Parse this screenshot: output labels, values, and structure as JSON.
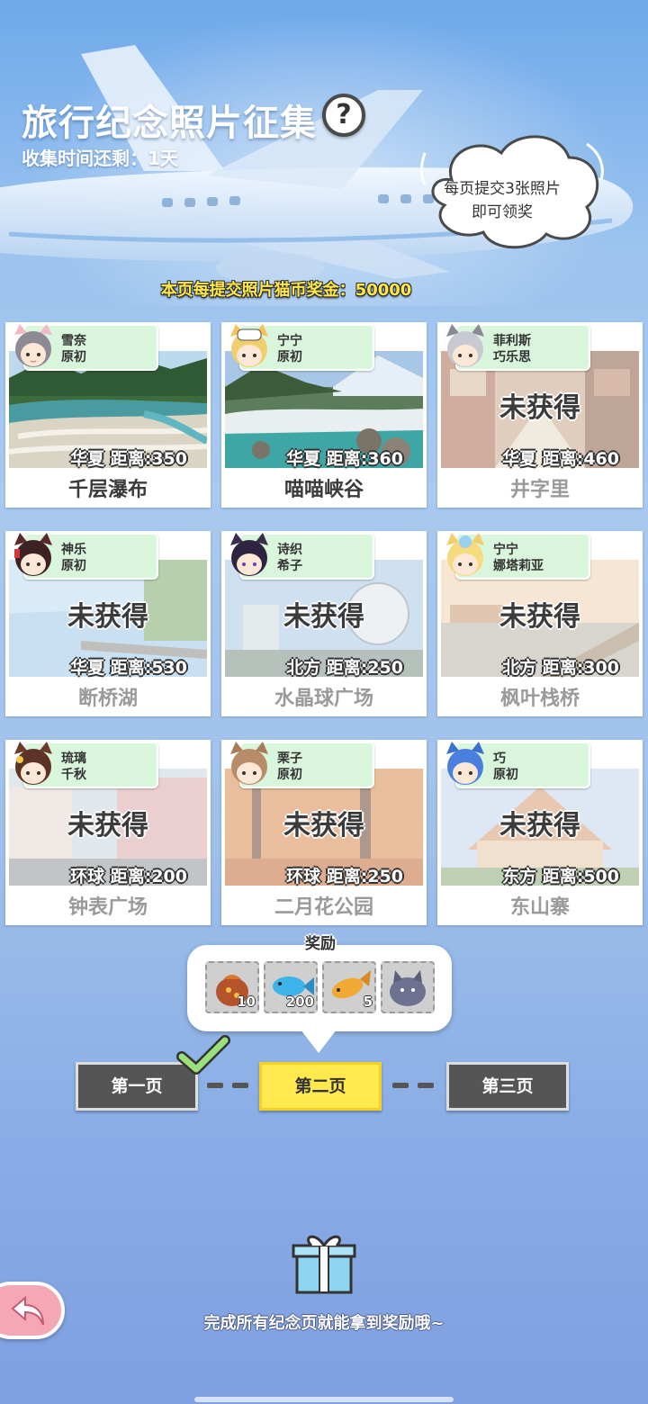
{
  "header": {
    "title": "旅行纪念照片征集",
    "help_glyph": "?",
    "time_label": "收集时间还剩：",
    "time_value": "1天",
    "bubble_line1": "每页提交3张照片",
    "bubble_line2": "即可领奖"
  },
  "bonus_text": "本页每提交照片猫币奖金：50000",
  "photos": [
    {
      "char_line1": "雪奈",
      "char_line2": "原初",
      "status": "",
      "region": "华夏",
      "distance": "距离:350",
      "name": "千层瀑布",
      "obtained": true
    },
    {
      "char_line1": "宁宁",
      "char_line2": "原初",
      "status": "",
      "region": "华夏",
      "distance": "距离:360",
      "name": "喵喵峡谷",
      "obtained": true
    },
    {
      "char_line1": "菲利斯",
      "char_line2": "巧乐思",
      "status": "未获得",
      "region": "华夏",
      "distance": "距离:460",
      "name": "井字里",
      "obtained": false
    },
    {
      "char_line1": "神乐",
      "char_line2": "原初",
      "status": "未获得",
      "region": "华夏",
      "distance": "距离:530",
      "name": "断桥湖",
      "obtained": false
    },
    {
      "char_line1": "诗织",
      "char_line2": "希子",
      "status": "未获得",
      "region": "北方",
      "distance": "距离:250",
      "name": "水晶球广场",
      "obtained": false
    },
    {
      "char_line1": "宁宁",
      "char_line2": "娜塔莉亚",
      "status": "未获得",
      "region": "北方",
      "distance": "距离:300",
      "name": "枫叶栈桥",
      "obtained": false
    },
    {
      "char_line1": "琉璃",
      "char_line2": "千秋",
      "status": "未获得",
      "region": "环球",
      "distance": "距离:200",
      "name": "钟表广场",
      "obtained": false
    },
    {
      "char_line1": "栗子",
      "char_line2": "原初",
      "status": "未获得",
      "region": "环球",
      "distance": "距离:250",
      "name": "二月花公园",
      "obtained": false
    },
    {
      "char_line1": "巧",
      "char_line2": "原初",
      "status": "未获得",
      "region": "东方",
      "distance": "距离:500",
      "name": "东山寨",
      "obtained": false
    }
  ],
  "rewards": {
    "title": "奖励",
    "items": [
      {
        "icon": "candy-bag-icon",
        "count": "10"
      },
      {
        "icon": "blue-fish-icon",
        "count": "200"
      },
      {
        "icon": "golden-fish-icon",
        "count": "5"
      },
      {
        "icon": "cat-plush-icon",
        "count": ""
      }
    ]
  },
  "pages": {
    "page1": "第一页",
    "page2": "第二页",
    "page3": "第三页",
    "active": "page2",
    "completed": [
      "page1"
    ]
  },
  "footer": {
    "text": "完成所有纪念页就能拿到奖励哦~"
  },
  "colors": {
    "accent_yellow": "#ffe94f",
    "tag_green": "#d9f5dc",
    "back_pink": "#f6a7b5"
  }
}
